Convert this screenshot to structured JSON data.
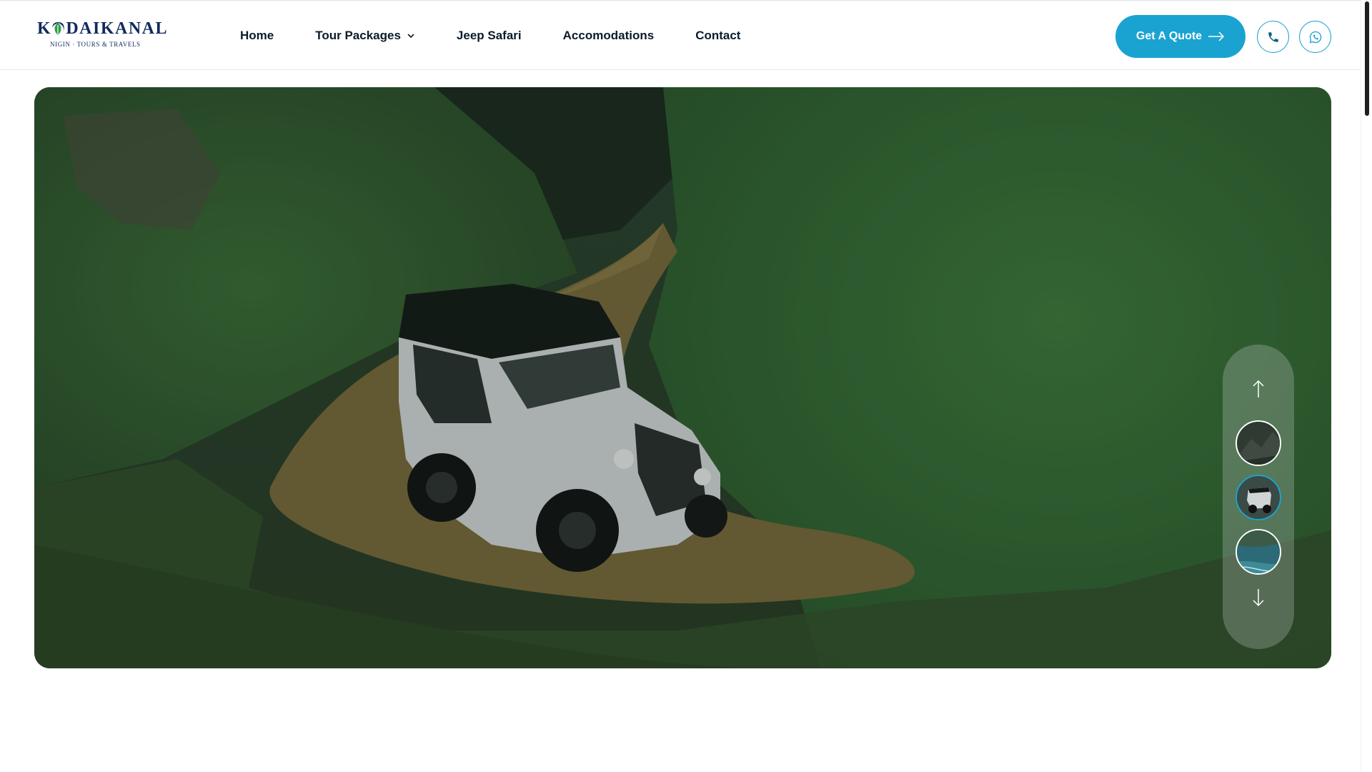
{
  "brand": {
    "name": "KODAIKANAL",
    "tagline": "NIGIN · TOURS & TRAVELS",
    "color": "#112a5e",
    "leaf_color": "#2e9e4a"
  },
  "nav": {
    "items": [
      {
        "label": "Home"
      },
      {
        "label": "Tour Packages",
        "has_dropdown": true
      },
      {
        "label": "Jeep Safari"
      },
      {
        "label": "Accomodations"
      },
      {
        "label": "Contact"
      }
    ]
  },
  "actions": {
    "quote_label": "Get A Quote",
    "quote_icon": "arrow-right-icon",
    "phone_icon": "phone-icon",
    "whatsapp_icon": "whatsapp-icon",
    "accent": "#1aa3d1"
  },
  "hero": {
    "image": "white jeep driving on a dirt trail through green hills",
    "slider": {
      "up_icon": "arrow-up-icon",
      "down_icon": "arrow-down-icon",
      "thumbnails": [
        {
          "name": "mountain-thumbnail",
          "active": false
        },
        {
          "name": "jeep-thumbnail",
          "active": true
        },
        {
          "name": "lake-thumbnail",
          "active": false
        }
      ]
    }
  }
}
